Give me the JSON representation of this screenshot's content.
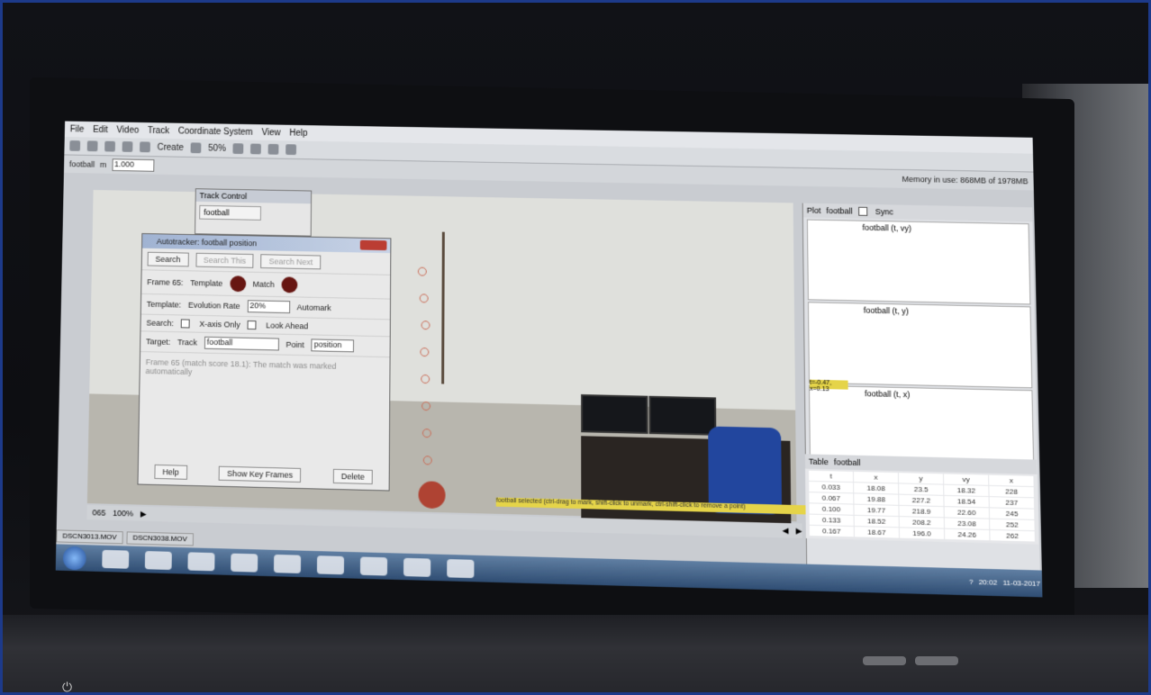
{
  "menu": [
    "File",
    "Edit",
    "Video",
    "Track",
    "Coordinate System",
    "View",
    "Help"
  ],
  "toolbar": {
    "create_label": "Create",
    "zoom": "50%"
  },
  "track": {
    "name": "football",
    "mass_label": "m",
    "mass_value": "1.000"
  },
  "track_control": {
    "title": "Track Control",
    "item": "football"
  },
  "autotracker": {
    "title": "Autotracker: football position",
    "search_label": "Search",
    "search_this_label": "Search This",
    "search_next_label": "Search Next",
    "frame_label": "Frame 65:",
    "template_label": "Template",
    "match_label": "Match",
    "template_row_label": "Template:",
    "evolution_rate_label": "Evolution Rate",
    "evolution_rate_value": "20%",
    "automark_label": "Automark",
    "search_row_label": "Search:",
    "xaxis_only_label": "X-axis Only",
    "look_ahead_label": "Look Ahead",
    "target_label": "Target:",
    "track_label": "Track",
    "track_value": "football",
    "point_label": "Point",
    "point_value": "position",
    "message": "Frame 65 (match score 18.1): The match was marked automatically",
    "help_label": "Help",
    "show_key_frames_label": "Show Key Frames",
    "delete_label": "Delete"
  },
  "plots": [
    {
      "title": "football (t, vy)"
    },
    {
      "title": "football (t, y)"
    },
    {
      "title": "football (t, x)"
    }
  ],
  "plot_toolbar": {
    "plot_label": "Plot",
    "track_value": "football",
    "sync_label": "Sync"
  },
  "memory_label": "Memory in use: 868MB of 1978MB",
  "coord_readout": "t=-0.47, x=0.13",
  "table": {
    "label": "Table",
    "track_value": "football",
    "rows": [
      [
        "t",
        "x",
        "y",
        "vy",
        "x"
      ],
      [
        "0.033",
        "18.08",
        "23.5",
        "18.32",
        "228"
      ],
      [
        "0.067",
        "19.88",
        "227.2",
        "18.54",
        "237"
      ],
      [
        "0.100",
        "19.77",
        "218.9",
        "22.60",
        "245"
      ],
      [
        "0.133",
        "18.52",
        "208.2",
        "23.08",
        "252"
      ],
      [
        "0.167",
        "18.67",
        "196.0",
        "24.26",
        "262"
      ]
    ]
  },
  "status_text": "football selected (ctrl-drag to mark, shift-click to unmark, ctrl-shift-click to remove a point)",
  "playbar": {
    "zoom_label": "100%",
    "frame_label": "065"
  },
  "file_tabs": [
    "DSCN3013.MOV",
    "DSCN3038.MOV"
  ],
  "tray": {
    "time": "20:02",
    "date": "11-03-2017"
  },
  "colors": {
    "taskbar": "#2c4d78",
    "ball": "#b8412f",
    "status_bg": "#e8d53a",
    "chair": "#1e46a8"
  }
}
